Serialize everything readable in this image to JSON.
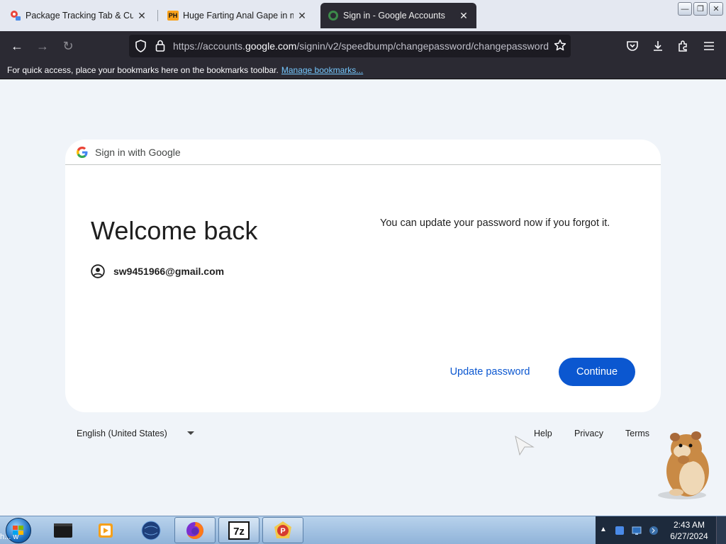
{
  "tabs": [
    {
      "title": "Package Tracking Tab & Custom",
      "close": "✕",
      "favicon": "tracking-favicon"
    },
    {
      "title": "Huge Farting Anal Gape in my",
      "close": "✕",
      "favicon": "ph-favicon",
      "favicon_text": "PH"
    },
    {
      "title": "Sign in - Google Accounts",
      "close": "✕",
      "favicon": "google-favicon",
      "active": true
    }
  ],
  "window_controls": {
    "minimize": "—",
    "restore": "❐",
    "close": "✕"
  },
  "nav": {
    "back_icon": "←",
    "forward_icon": "→",
    "reload_icon": "↻",
    "url_scheme": "https://accounts.",
    "url_host": "google.com",
    "url_path": "/signin/v2/speedbump/changepassword/changepassword?"
  },
  "bookmarks_bar": {
    "message": "For quick access, place your bookmarks here on the bookmarks toolbar.",
    "link": "Manage bookmarks..."
  },
  "card": {
    "header": "Sign in with Google",
    "heading": "Welcome back",
    "email": "sw9451966@gmail.com",
    "description": "You can update your password now if you forgot it.",
    "update_button": "Update password",
    "continue_button": "Continue"
  },
  "footer": {
    "language": "English (United States)",
    "links": [
      "Help",
      "Privacy",
      "Terms"
    ]
  },
  "taskbar": {
    "clock_time": "2:43 AM",
    "clock_date": "6/27/2024",
    "desktop_label": "h... w"
  },
  "colors": {
    "accent": "#0b57d0",
    "page_bg": "#f0f4f9",
    "browser_chrome": "#2b2a33"
  }
}
